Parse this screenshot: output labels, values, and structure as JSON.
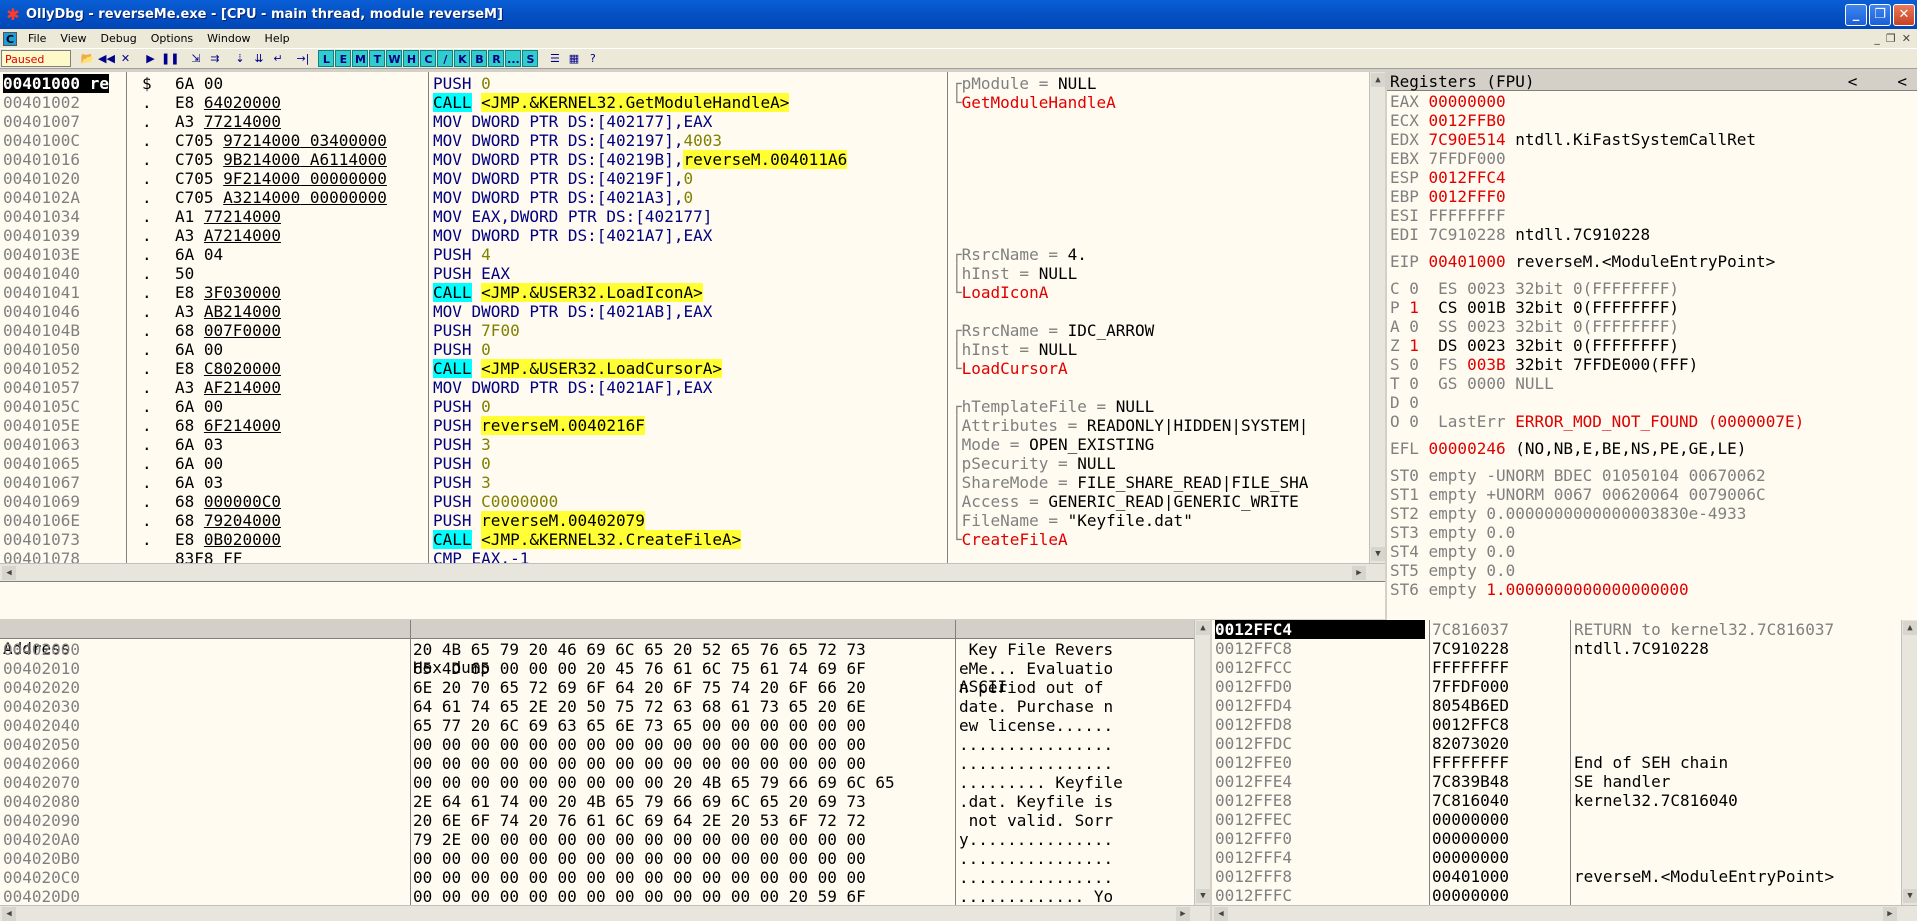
{
  "window": {
    "title": "OllyDbg - reverseMe.exe - [CPU - main thread, module reverseM]"
  },
  "menu": {
    "items": [
      "File",
      "View",
      "Debug",
      "Options",
      "Window",
      "Help"
    ]
  },
  "toolbar": {
    "status": "Paused",
    "letters": [
      "L",
      "E",
      "M",
      "T",
      "W",
      "H",
      "C",
      "/",
      "K",
      "B",
      "R",
      "...",
      "S"
    ]
  },
  "cpu": {
    "addresses": [
      "00401000 re",
      "00401002",
      "00401007",
      "0040100C",
      "00401016",
      "00401020",
      "0040102A",
      "00401034",
      "00401039",
      "0040103E",
      "00401040",
      "00401041",
      "00401046",
      "0040104B",
      "00401050",
      "00401052",
      "00401057",
      "0040105C",
      "0040105E",
      "00401063",
      "00401065",
      "00401067",
      "00401069",
      "0040106E",
      "00401073",
      "00401078"
    ],
    "marks": [
      "$",
      ".",
      ".",
      ".",
      ".",
      ".",
      ".",
      ".",
      ".",
      ".",
      ".",
      ".",
      ".",
      ".",
      ".",
      ".",
      ".",
      ".",
      ".",
      ".",
      ".",
      ".",
      ".",
      ".",
      ".",
      ""
    ],
    "hex": [
      [
        "6A 00"
      ],
      [
        "E8 ",
        "64020000"
      ],
      [
        "A3 ",
        "77214000"
      ],
      [
        "C705 ",
        "97214000",
        " 03400000"
      ],
      [
        "C705 ",
        "9B214000",
        " A6114000"
      ],
      [
        "C705 ",
        "9F214000",
        " 00000000"
      ],
      [
        "C705 ",
        "A3214000",
        " 00000000"
      ],
      [
        "A1 ",
        "77214000"
      ],
      [
        "A3 ",
        "A7214000"
      ],
      [
        "6A 04"
      ],
      [
        "50"
      ],
      [
        "E8 ",
        "3F030000"
      ],
      [
        "A3 ",
        "AB214000"
      ],
      [
        "68 ",
        "007F0000"
      ],
      [
        "6A 00"
      ],
      [
        "E8 ",
        "C8020000"
      ],
      [
        "A3 ",
        "AF214000"
      ],
      [
        "6A 00"
      ],
      [
        "68 ",
        "6F214000"
      ],
      [
        "6A 03"
      ],
      [
        "6A 00"
      ],
      [
        "6A 03"
      ],
      [
        "68 ",
        "000000C0"
      ],
      [
        "68 ",
        "79204000"
      ],
      [
        "E8 ",
        "0B020000"
      ],
      [
        "83F8 FF"
      ]
    ],
    "disasm": [
      [
        "PUSH ",
        "0"
      ],
      [
        "CALL",
        "<JMP.&KERNEL32.GetModuleHandleA>"
      ],
      [
        "MOV DWORD PTR DS:[402177],EAX"
      ],
      [
        "MOV DWORD PTR DS:[402197],",
        "4003"
      ],
      [
        "MOV DWORD PTR DS:[40219B],",
        "reverseM.004011A6"
      ],
      [
        "MOV DWORD PTR DS:[40219F],",
        "0"
      ],
      [
        "MOV DWORD PTR DS:[4021A3],",
        "0"
      ],
      [
        "MOV EAX,DWORD PTR DS:[402177]"
      ],
      [
        "MOV DWORD PTR DS:[4021A7],EAX"
      ],
      [
        "PUSH ",
        "4"
      ],
      [
        "PUSH EAX"
      ],
      [
        "CALL",
        "<JMP.&USER32.LoadIconA>"
      ],
      [
        "MOV DWORD PTR DS:[4021AB],EAX"
      ],
      [
        "PUSH ",
        "7F00"
      ],
      [
        "PUSH ",
        "0"
      ],
      [
        "CALL",
        "<JMP.&USER32.LoadCursorA>"
      ],
      [
        "MOV DWORD PTR DS:[4021AF],EAX"
      ],
      [
        "PUSH ",
        "0"
      ],
      [
        "PUSH ",
        "reverseM.0040216F"
      ],
      [
        "PUSH ",
        "3"
      ],
      [
        "PUSH ",
        "0"
      ],
      [
        "PUSH ",
        "3"
      ],
      [
        "PUSH ",
        "C0000000"
      ],
      [
        "PUSH ",
        "reverseM.00402079"
      ],
      [
        "CALL",
        "<JMP.&KERNEL32.CreateFileA>"
      ],
      [
        "CMP EAX,-1"
      ]
    ],
    "comments": [
      [
        "┌pModule = ",
        "NULL"
      ],
      [
        "└",
        "GetModuleHandleA"
      ],
      [
        ""
      ],
      [
        ""
      ],
      [
        ""
      ],
      [
        ""
      ],
      [
        ""
      ],
      [
        ""
      ],
      [
        ""
      ],
      [
        "┌RsrcName = ",
        "4."
      ],
      [
        "│hInst = ",
        "NULL"
      ],
      [
        "└",
        "LoadIconA"
      ],
      [
        ""
      ],
      [
        "┌RsrcName = ",
        "IDC_ARROW"
      ],
      [
        "│hInst = ",
        "NULL"
      ],
      [
        "└",
        "LoadCursorA"
      ],
      [
        ""
      ],
      [
        "┌hTemplateFile = ",
        "NULL"
      ],
      [
        "│Attributes = ",
        "READONLY|HIDDEN|SYSTEM|"
      ],
      [
        "│Mode = ",
        "OPEN_EXISTING"
      ],
      [
        "│pSecurity = ",
        "NULL"
      ],
      [
        "│ShareMode = ",
        "FILE_SHARE_READ|FILE_SHA"
      ],
      [
        "│Access = ",
        "GENERIC_READ|GENERIC_WRITE"
      ],
      [
        "│FileName = ",
        "\"Keyfile.dat\""
      ],
      [
        "└",
        "CreateFileA"
      ],
      [
        ""
      ]
    ]
  },
  "registers": {
    "header": "Registers (FPU)",
    "lines": [
      [
        "EAX ",
        "00000000",
        ""
      ],
      [
        "ECX ",
        "0012FFB0",
        ""
      ],
      [
        "EDX ",
        "7C90E514",
        " ntdll.KiFastSystemCallRet"
      ],
      [
        "EBX ",
        "7FFDF000",
        ""
      ],
      [
        "ESP ",
        "0012FFC4",
        ""
      ],
      [
        "EBP ",
        "0012FFF0",
        ""
      ],
      [
        "ESI ",
        "FFFFFFFF",
        ""
      ],
      [
        "EDI ",
        "7C910228",
        " ntdll.7C910228"
      ],
      [
        "",
        "",
        " "
      ],
      [
        "EIP ",
        "00401000",
        " reverseM.<ModuleEntryPoint>"
      ],
      [
        "",
        "",
        " "
      ],
      [
        "C 0  ES 0023 32bit 0(FFFFFFFF)",
        "",
        ""
      ],
      [
        "P ",
        "1",
        "  CS 001B 32bit 0(FFFFFFFF)"
      ],
      [
        "A 0  SS 0023 32bit 0(FFFFFFFF)",
        "",
        ""
      ],
      [
        "Z ",
        "1",
        "  DS 0023 32bit 0(FFFFFFFF)"
      ],
      [
        "S 0  FS ",
        "003B",
        " 32bit 7FFDE000(FFF)"
      ],
      [
        "T 0  GS 0000 NULL",
        "",
        ""
      ],
      [
        "D 0",
        "",
        ""
      ],
      [
        "O 0  LastErr ",
        "ERROR_MOD_NOT_FOUND (0000007E)",
        ""
      ],
      [
        "",
        "",
        " "
      ],
      [
        "EFL ",
        "00000246",
        " (NO,NB,E,BE,NS,PE,GE,LE)"
      ],
      [
        "",
        "",
        " "
      ],
      [
        "ST0 empty -UNORM BDEC 01050104 00670062",
        "",
        ""
      ],
      [
        "ST1 empty +UNORM 0067 00620064 0079006C",
        "",
        ""
      ],
      [
        "ST2 empty 0.0000000000000003830e-4933",
        "",
        ""
      ],
      [
        "ST3 empty 0.0",
        "",
        ""
      ],
      [
        "ST4 empty 0.0",
        "",
        ""
      ],
      [
        "ST5 empty 0.0",
        "",
        ""
      ],
      [
        "ST6 empty ",
        "1.0000000000000000000",
        ""
      ]
    ]
  },
  "dump": {
    "headers": {
      "address": "Address",
      "hex": "Hex dump",
      "ascii": "ASCII"
    },
    "addresses": [
      "00402000",
      "00402010",
      "00402020",
      "00402030",
      "00402040",
      "00402050",
      "00402060",
      "00402070",
      "00402080",
      "00402090",
      "004020A0",
      "004020B0",
      "004020C0",
      "004020D0"
    ],
    "hex": [
      "20 4B 65 79 20 46 69 6C 65 20 52 65 76 65 72 73",
      "65 4D 65 00 00 00 20 45 76 61 6C 75 61 74 69 6F",
      "6E 20 70 65 72 69 6F 64 20 6F 75 74 20 6F 66 20",
      "64 61 74 65 2E 20 50 75 72 63 68 61 73 65 20 6E",
      "65 77 20 6C 69 63 65 6E 73 65 00 00 00 00 00 00",
      "00 00 00 00 00 00 00 00 00 00 00 00 00 00 00 00",
      "00 00 00 00 00 00 00 00 00 00 00 00 00 00 00 00",
      "00 00 00 00 00 00 00 00 00 20 4B 65 79 66 69 6C 65",
      "2E 64 61 74 00 20 4B 65 79 66 69 6C 65 20 69 73",
      "20 6E 6F 74 20 76 61 6C 69 64 2E 20 53 6F 72 72",
      "79 2E 00 00 00 00 00 00 00 00 00 00 00 00 00 00",
      "00 00 00 00 00 00 00 00 00 00 00 00 00 00 00 00",
      "00 00 00 00 00 00 00 00 00 00 00 00 00 00 00 00",
      "00 00 00 00 00 00 00 00 00 00 00 00 00 20 59 6F"
    ],
    "ascii": [
      " Key File Revers",
      "eMe... Evaluatio",
      "n period out of ",
      "date. Purchase n",
      "ew license......",
      "................",
      "................",
      "......... Keyfile",
      ".dat. Keyfile is",
      " not valid. Sorr",
      "y...............",
      "................",
      "................",
      "............. Yo"
    ]
  },
  "stack": {
    "rows": [
      [
        "0012FFC4",
        "7C816037",
        "RETURN to kernel32.7C816037"
      ],
      [
        "0012FFC8",
        "7C910228",
        "ntdll.7C910228"
      ],
      [
        "0012FFCC",
        "FFFFFFFF",
        ""
      ],
      [
        "0012FFD0",
        "7FFDF000",
        ""
      ],
      [
        "0012FFD4",
        "8054B6ED",
        ""
      ],
      [
        "0012FFD8",
        "0012FFC8",
        ""
      ],
      [
        "0012FFDC",
        "82073020",
        ""
      ],
      [
        "0012FFE0",
        "FFFFFFFF",
        "End of SEH chain"
      ],
      [
        "0012FFE4",
        "7C839B48",
        "SE handler"
      ],
      [
        "0012FFE8",
        "7C816040",
        "kernel32.7C816040"
      ],
      [
        "0012FFEC",
        "00000000",
        ""
      ],
      [
        "0012FFF0",
        "00000000",
        ""
      ],
      [
        "0012FFF4",
        "00000000",
        ""
      ],
      [
        "0012FFF8",
        "00401000",
        "reverseM.<ModuleEntryPoint>"
      ],
      [
        "0012FFFC",
        "00000000",
        ""
      ]
    ]
  },
  "colors": {
    "title": "#0653c6",
    "pane_bg": "#fffbf0",
    "highlight_yellow": "#ffff33",
    "highlight_cyan": "#00ffff",
    "changed_red": "#e00000",
    "address_gray": "#808080"
  }
}
